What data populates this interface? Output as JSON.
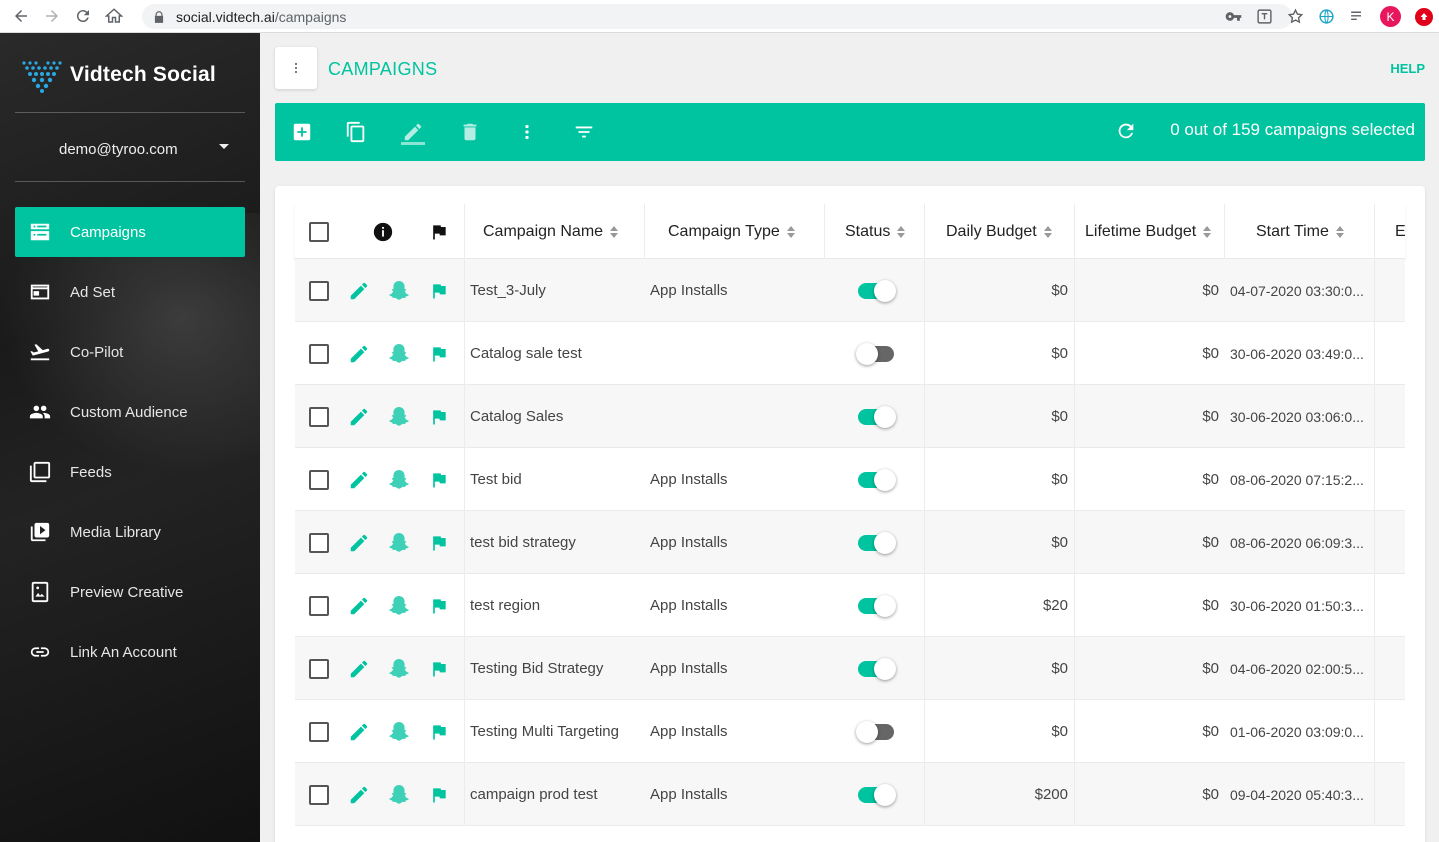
{
  "browser": {
    "url_host": "social.vidtech.ai",
    "url_path": "/campaigns",
    "avatar_letter": "K"
  },
  "brand": {
    "name": "Vidtech Social"
  },
  "user": {
    "email": "demo@tyroo.com"
  },
  "sidebar": {
    "items": [
      {
        "label": "Campaigns",
        "icon": "campaigns-icon",
        "active": true
      },
      {
        "label": "Ad Set",
        "icon": "ad-set-icon",
        "active": false
      },
      {
        "label": "Co-Pilot",
        "icon": "plane-icon",
        "active": false
      },
      {
        "label": "Custom Audience",
        "icon": "people-icon",
        "active": false
      },
      {
        "label": "Feeds",
        "icon": "feeds-icon",
        "active": false
      },
      {
        "label": "Media Library",
        "icon": "media-library-icon",
        "active": false
      },
      {
        "label": "Preview Creative",
        "icon": "preview-icon",
        "active": false
      },
      {
        "label": "Link An Account",
        "icon": "link-icon",
        "active": false
      }
    ]
  },
  "page": {
    "title": "CAMPAIGNS",
    "help": "HELP"
  },
  "toolbar": {
    "selection_text": "0 out of 159 campaigns selected"
  },
  "table": {
    "columns": {
      "name": "Campaign Name",
      "type": "Campaign Type",
      "status": "Status",
      "daily": "Daily Budget",
      "lifetime": "Lifetime Budget",
      "start": "Start Time",
      "end": "E"
    },
    "rows": [
      {
        "name": "Test_3-July",
        "type": "App Installs",
        "status": true,
        "daily": "$0",
        "lifetime": "$0",
        "start": "04-07-2020 03:30:0..."
      },
      {
        "name": "Catalog sale test",
        "type": "",
        "status": false,
        "daily": "$0",
        "lifetime": "$0",
        "start": "30-06-2020 03:49:0..."
      },
      {
        "name": "Catalog Sales",
        "type": "",
        "status": true,
        "daily": "$0",
        "lifetime": "$0",
        "start": "30-06-2020 03:06:0..."
      },
      {
        "name": "Test bid",
        "type": "App Installs",
        "status": true,
        "daily": "$0",
        "lifetime": "$0",
        "start": "08-06-2020 07:15:2..."
      },
      {
        "name": "test bid strategy",
        "type": "App Installs",
        "status": true,
        "daily": "$0",
        "lifetime": "$0",
        "start": "08-06-2020 06:09:3..."
      },
      {
        "name": "test region",
        "type": "App Installs",
        "status": true,
        "daily": "$20",
        "lifetime": "$0",
        "start": "30-06-2020 01:50:3..."
      },
      {
        "name": "Testing Bid Strategy",
        "type": "App Installs",
        "status": true,
        "daily": "$0",
        "lifetime": "$0",
        "start": "04-06-2020 02:00:5..."
      },
      {
        "name": "Testing Multi Targeting",
        "type": "App Installs",
        "status": false,
        "daily": "$0",
        "lifetime": "$0",
        "start": "01-06-2020 03:09:0..."
      },
      {
        "name": "campaign prod test",
        "type": "App Installs",
        "status": true,
        "daily": "$200",
        "lifetime": "$0",
        "start": "09-04-2020 05:40:3..."
      }
    ]
  },
  "colors": {
    "accent": "#00c4a0",
    "sidebar_bg": "#1c1c1c"
  }
}
